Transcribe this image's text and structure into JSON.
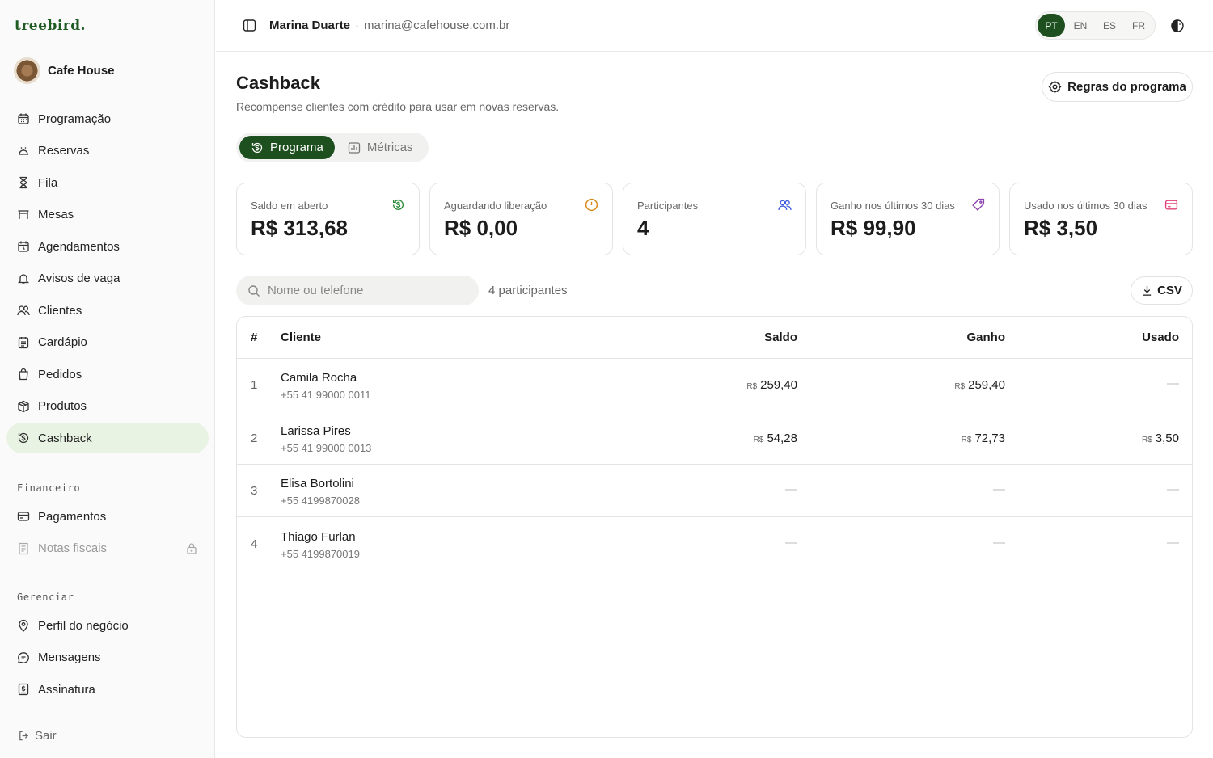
{
  "app": {
    "brand": "treebird.",
    "business_name": "Cafe House"
  },
  "sidebar": {
    "items": [
      {
        "label": "Programação",
        "icon": "calendar-icon"
      },
      {
        "label": "Reservas",
        "icon": "reservation-icon"
      },
      {
        "label": "Fila",
        "icon": "hourglass-icon"
      },
      {
        "label": "Mesas",
        "icon": "table-icon"
      },
      {
        "label": "Agendamentos",
        "icon": "calendar-clock-icon"
      },
      {
        "label": "Avisos de vaga",
        "icon": "bell-icon"
      },
      {
        "label": "Clientes",
        "icon": "users-icon"
      },
      {
        "label": "Cardápio",
        "icon": "menu-book-icon"
      },
      {
        "label": "Pedidos",
        "icon": "bag-icon"
      },
      {
        "label": "Produtos",
        "icon": "box-icon"
      },
      {
        "label": "Cashback",
        "icon": "cashback-icon",
        "active": true
      }
    ],
    "section_financeiro": "Financeiro",
    "financeiro_items": [
      {
        "label": "Pagamentos",
        "icon": "credit-card-icon"
      },
      {
        "label": "Notas fiscais",
        "icon": "receipt-icon",
        "locked": true
      }
    ],
    "section_gerenciar": "Gerenciar",
    "gerenciar_items": [
      {
        "label": "Perfil do negócio",
        "icon": "location-pin-icon"
      },
      {
        "label": "Mensagens",
        "icon": "message-icon"
      },
      {
        "label": "Assinatura",
        "icon": "subscription-icon"
      }
    ],
    "logout": "Sair"
  },
  "topbar": {
    "user_name": "Marina Duarte",
    "separator": "·",
    "user_email": "marina@cafehouse.com.br",
    "languages": [
      "PT",
      "EN",
      "ES",
      "FR"
    ],
    "active_language": "PT"
  },
  "page": {
    "title": "Cashback",
    "subtitle": "Recompense clientes com crédito para usar em novas reservas.",
    "rules_button": "Regras do programa",
    "tabs": [
      {
        "label": "Programa",
        "active": true
      },
      {
        "label": "Métricas",
        "active": false
      }
    ]
  },
  "stats": [
    {
      "label": "Saldo em aberto",
      "value": "R$ 313,68",
      "icon": "cashback-icon",
      "color": "#2e8b3a"
    },
    {
      "label": "Aguardando liberação",
      "value": "R$ 0,00",
      "icon": "clock-icon",
      "color": "#d98a1a"
    },
    {
      "label": "Participantes",
      "value": "4",
      "icon": "users-icon",
      "color": "#3b5bdb"
    },
    {
      "label": "Ganho nos últimos 30 dias",
      "value": "R$ 99,90",
      "icon": "tag-icon",
      "color": "#8e44ad"
    },
    {
      "label": "Usado nos últimos 30 dias",
      "value": "R$ 3,50",
      "icon": "card-icon",
      "color": "#e0417a"
    }
  ],
  "search": {
    "placeholder": "Nome ou telefone"
  },
  "participants_count": "4 participantes",
  "csv_button": "CSV",
  "table": {
    "headers": {
      "num": "#",
      "client": "Cliente",
      "balance": "Saldo",
      "earned": "Ganho",
      "used": "Usado"
    },
    "currency": "R$",
    "empty": "—",
    "rows": [
      {
        "n": "1",
        "name": "Camila Rocha",
        "phone": "+55 41 99000 0011",
        "balance": "259,40",
        "earned": "259,40",
        "used": ""
      },
      {
        "n": "2",
        "name": "Larissa Pires",
        "phone": "+55 41 99000 0013",
        "balance": "54,28",
        "earned": "72,73",
        "used": "3,50"
      },
      {
        "n": "3",
        "name": "Elisa Bortolini",
        "phone": "+55 4199870028",
        "balance": "",
        "earned": "",
        "used": ""
      },
      {
        "n": "4",
        "name": "Thiago Furlan",
        "phone": "+55 4199870019",
        "balance": "",
        "earned": "",
        "used": ""
      }
    ]
  }
}
